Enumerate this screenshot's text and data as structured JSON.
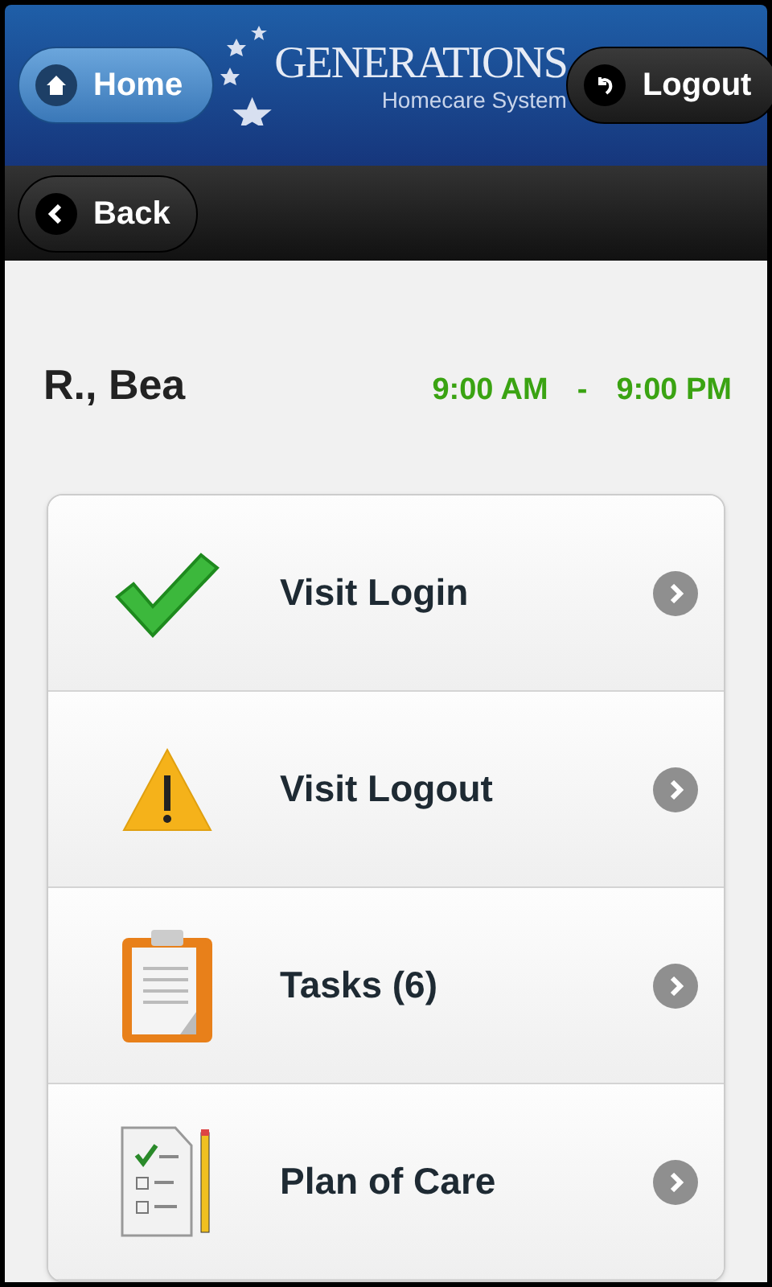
{
  "header": {
    "home_button": "Home",
    "logo": {
      "title": "GENERATIONS",
      "subtitle": "Homecare System"
    },
    "logout_button": "Logout"
  },
  "toolbar": {
    "back_button": "Back"
  },
  "client": {
    "name": "R., Bea",
    "start_time": "9:00 AM",
    "separator": "-",
    "end_time": "9:00 PM"
  },
  "menu": [
    {
      "label": "Visit Login",
      "kind": "check"
    },
    {
      "label": "Visit Logout",
      "kind": "warning"
    },
    {
      "label": "Tasks (6)",
      "kind": "clipboard"
    },
    {
      "label": "Plan of Care",
      "kind": "checklist"
    }
  ]
}
